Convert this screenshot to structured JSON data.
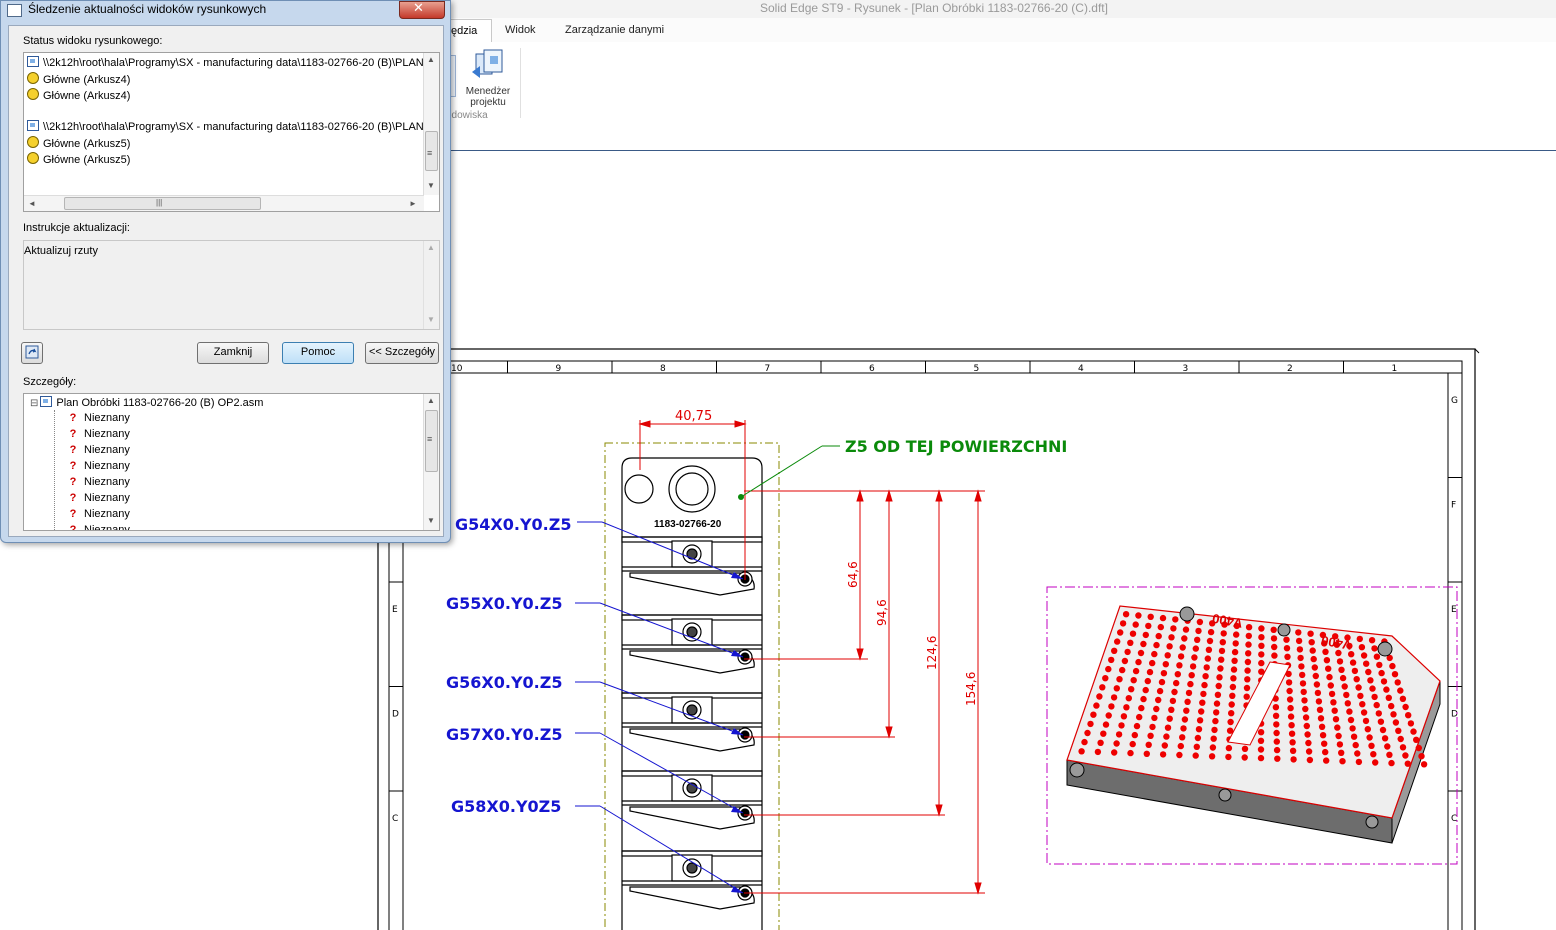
{
  "app": {
    "title": "Solid Edge ST9 - Rysunek - [Plan Obróbki 1183-02766-20 (C).dft]"
  },
  "ribbon": {
    "tabs": [
      "ędzia",
      "Widok",
      "Zarządzanie danymi"
    ],
    "manager_label_1": "Menedżer",
    "manager_label_2": "projektu",
    "group_label": "odowiska",
    "partial_label": "i"
  },
  "dialog": {
    "title": "Śledzenie aktualności widoków rysunkowych",
    "close_glyph": "✕",
    "status_label": "Status widoku rysunkowego:",
    "status_rows": [
      {
        "icon": "sheet",
        "text": "\\\\2k12h\\root\\hala\\Programy\\SX - manufacturing data\\1183-02766-20 (B)\\PLAN"
      },
      {
        "icon": "clock",
        "text": "Główne (Arkusz4)"
      },
      {
        "icon": "clock",
        "text": "Główne (Arkusz4)"
      },
      {
        "icon": "none",
        "text": ""
      },
      {
        "icon": "sheet",
        "text": "\\\\2k12h\\root\\hala\\Programy\\SX - manufacturing data\\1183-02766-20 (B)\\PLAN"
      },
      {
        "icon": "clock",
        "text": "Główne (Arkusz5)"
      },
      {
        "icon": "clock",
        "text": "Główne (Arkusz5)"
      }
    ],
    "instructions_label": "Instrukcje aktualizacji:",
    "instructions_text": "Aktualizuj rzuty",
    "btn_close": "Zamknij",
    "btn_help": "Pomoc",
    "btn_details": "<< Szczegóły",
    "details_label": "Szczegóły:",
    "details_root": "Plan Obróbki 1183-02766-20 (B) OP2.asm",
    "details_items": [
      "Nieznany",
      "Nieznany",
      "Nieznany",
      "Nieznany",
      "Nieznany",
      "Nieznany",
      "Nieznany",
      "Nieznany"
    ],
    "scroll_glyphs": {
      "up": "▲",
      "down": "▼",
      "left": "◄",
      "right": "►",
      "grip_v": "≡",
      "grip_h": "|||",
      "collapse": "⊟"
    }
  },
  "drawing": {
    "part_label": "1183-02766-20",
    "dim_top": "40,75",
    "dims_vertical": [
      "64,6",
      "94,6",
      "124,6",
      "154,6"
    ],
    "note": "Z5 OD TEJ POWIERZCHNI",
    "gcodes": [
      "G54X0.Y0.Z5",
      "G55X0.Y0.Z5",
      "G56X0.Y0.Z5",
      "G57X0.Y0.Z5",
      "G58X0.Y0Z5"
    ],
    "border_cols": [
      "10",
      "9",
      "8",
      "7",
      "6",
      "5",
      "4",
      "3",
      "2",
      "1"
    ],
    "border_rows": [
      "G",
      "F",
      "E",
      "D",
      "C"
    ],
    "iso_text": "V400",
    "colors": {
      "dim": "#e00000",
      "gcode": "#1515d0",
      "note": "#0a8a0a",
      "iso_red": "#ee0000",
      "mag": "#c000c0"
    }
  }
}
